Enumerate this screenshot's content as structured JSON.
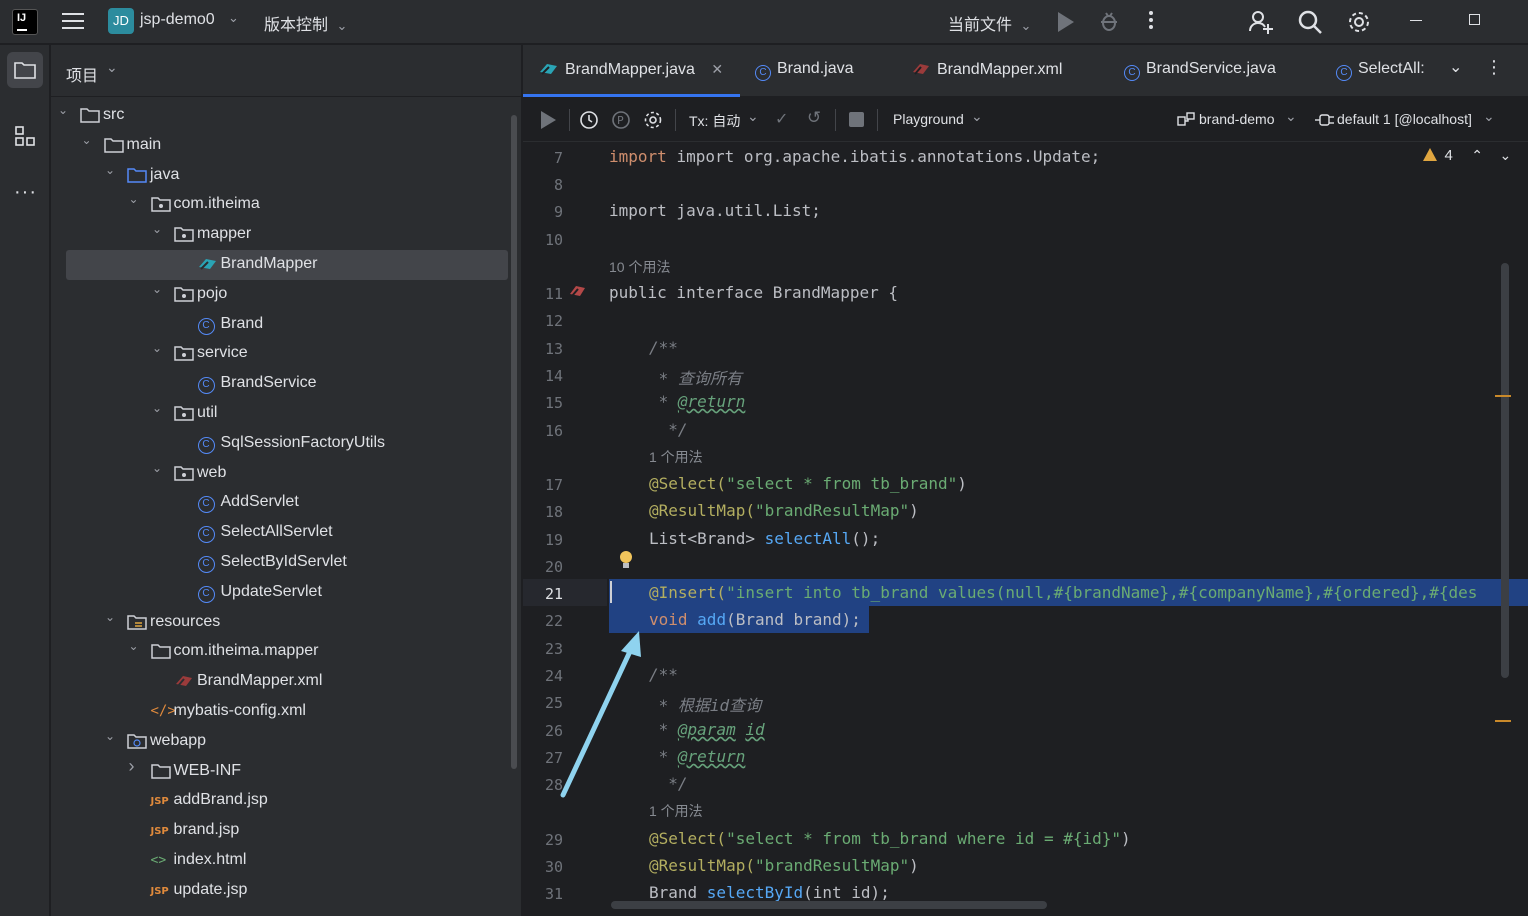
{
  "titlebar": {
    "logo": "IJ",
    "project_badge": "JD",
    "project_name": "jsp-demo0",
    "vcs_label": "版本控制",
    "run_config": "当前文件"
  },
  "sidebar": {
    "panel_title": "项目",
    "tree": [
      {
        "label": "src",
        "depth": 1,
        "icon": "folder",
        "expanded": true
      },
      {
        "label": "main",
        "depth": 2,
        "icon": "folder",
        "expanded": true
      },
      {
        "label": "java",
        "depth": 3,
        "icon": "source-folder",
        "expanded": true
      },
      {
        "label": "com.itheima",
        "depth": 4,
        "icon": "package",
        "expanded": true
      },
      {
        "label": "mapper",
        "depth": 5,
        "icon": "package",
        "expanded": true
      },
      {
        "label": "BrandMapper",
        "depth": 6,
        "icon": "mapper-interface",
        "selected": true
      },
      {
        "label": "pojo",
        "depth": 5,
        "icon": "package",
        "expanded": true
      },
      {
        "label": "Brand",
        "depth": 6,
        "icon": "class"
      },
      {
        "label": "service",
        "depth": 5,
        "icon": "package",
        "expanded": true
      },
      {
        "label": "BrandService",
        "depth": 6,
        "icon": "class"
      },
      {
        "label": "util",
        "depth": 5,
        "icon": "package",
        "expanded": true
      },
      {
        "label": "SqlSessionFactoryUtils",
        "depth": 6,
        "icon": "class"
      },
      {
        "label": "web",
        "depth": 5,
        "icon": "package",
        "expanded": true
      },
      {
        "label": "AddServlet",
        "depth": 6,
        "icon": "class"
      },
      {
        "label": "SelectAllServlet",
        "depth": 6,
        "icon": "class"
      },
      {
        "label": "SelectByIdServlet",
        "depth": 6,
        "icon": "class"
      },
      {
        "label": "UpdateServlet",
        "depth": 6,
        "icon": "class"
      },
      {
        "label": "resources",
        "depth": 3,
        "icon": "resources-folder",
        "expanded": true
      },
      {
        "label": "com.itheima.mapper",
        "depth": 4,
        "icon": "folder",
        "expanded": true
      },
      {
        "label": "BrandMapper.xml",
        "depth": 5,
        "icon": "mybatis-xml"
      },
      {
        "label": "mybatis-config.xml",
        "depth": 4,
        "icon": "xml"
      },
      {
        "label": "webapp",
        "depth": 3,
        "icon": "web-folder",
        "expanded": true
      },
      {
        "label": "WEB-INF",
        "depth": 4,
        "icon": "folder",
        "expanded": false
      },
      {
        "label": "addBrand.jsp",
        "depth": 4,
        "icon": "jsp"
      },
      {
        "label": "brand.jsp",
        "depth": 4,
        "icon": "jsp"
      },
      {
        "label": "index.html",
        "depth": 4,
        "icon": "html"
      },
      {
        "label": "update.jsp",
        "depth": 4,
        "icon": "jsp"
      }
    ]
  },
  "tabs": [
    {
      "label": "BrandMapper.java",
      "icon": "mapper-interface",
      "active": true
    },
    {
      "label": "Brand.java",
      "icon": "class"
    },
    {
      "label": "BrandMapper.xml",
      "icon": "mybatis-xml"
    },
    {
      "label": "BrandService.java",
      "icon": "class"
    },
    {
      "label": "SelectAll:",
      "icon": "class"
    }
  ],
  "toolbar": {
    "tx_label": "Tx: 自动",
    "playground": "Playground",
    "datasource": "brand-demo",
    "session": "default 1 [@localhost]"
  },
  "inspections": {
    "warnings": "4"
  },
  "usages": {
    "ten": "10 个用法",
    "one_a": "1 个用法",
    "one_b": "1 个用法"
  },
  "line_numbers": [
    "7",
    "8",
    "9",
    "10",
    "11",
    "12",
    "13",
    "14",
    "15",
    "16",
    "17",
    "18",
    "19",
    "20",
    "21",
    "22",
    "23",
    "24",
    "25",
    "26",
    "27",
    "28",
    "29",
    "30",
    "31"
  ],
  "code": {
    "l7": "import org.apache.ibatis.annotations.Update;",
    "l9": "import java.util.List;",
    "l11": "public interface BrandMapper {",
    "l13": "/**",
    "l14": "查询所有",
    "l15": "@return",
    "l16": "*/",
    "l17a": "@Select(",
    "l17b": "\"select * from tb_brand\"",
    "l17c": ")",
    "l18a": "@ResultMap(",
    "l18b": "\"brandResultMap\"",
    "l18c": ")",
    "l19a": "List<Brand> ",
    "l19b": "selectAll",
    "l19c": "();",
    "l21a": "@Insert(",
    "l21b": "\"insert into tb_brand values(null,#{brandName},#{companyName},#{ordered},#{des",
    "l22a": "void ",
    "l22b": "add",
    "l22c": "(Brand brand);",
    "l24": "/**",
    "l25": "根据id查询",
    "l26a": "@param",
    "l26b": "id",
    "l27": "@return",
    "l28": "*/",
    "l29a": "@Select(",
    "l29b": "\"select * from tb_brand where id = #{id}\"",
    "l29c": ")",
    "l30a": "@ResultMap(",
    "l30b": "\"brandResultMap\"",
    "l30c": ")",
    "l31a": "Brand ",
    "l31b": "selectById",
    "l31c": "(int id);"
  },
  "colors": {
    "accent": "#3574f0",
    "selection": "#214283",
    "arrow": "#8fd3ef"
  }
}
